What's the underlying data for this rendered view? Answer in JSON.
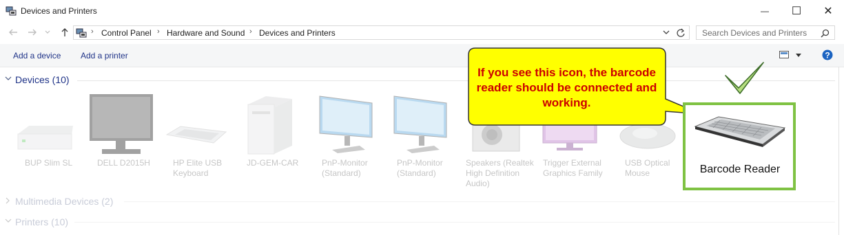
{
  "window": {
    "title": "Devices and Printers",
    "icon": "devices-and-printers-icon",
    "minimize_glyph": "—",
    "maximize_glyph": "☐",
    "close_glyph": "✕"
  },
  "address": {
    "crumbs": [
      "Control Panel",
      "Hardware and Sound",
      "Devices and Printers"
    ],
    "search_placeholder": "Search Devices and Printers"
  },
  "commands": {
    "add_device": "Add a device",
    "add_printer": "Add a printer"
  },
  "groups": {
    "devices": {
      "title": "Devices (10)"
    },
    "multimedia": {
      "title": "Multimedia Devices (2)"
    },
    "printers": {
      "title": "Printers (10)"
    }
  },
  "devices": [
    {
      "label": "BUP Slim SL",
      "icon": "external-drive-icon"
    },
    {
      "label": "DELL D2015H",
      "icon": "monitor-icon"
    },
    {
      "label": "HP Elite USB\nKeyboard",
      "icon": "keyboard-icon"
    },
    {
      "label": "JD-GEM-CAR",
      "icon": "computer-tower-icon"
    },
    {
      "label": "PnP-Monitor\n(Standard)",
      "icon": "monitor-icon"
    },
    {
      "label": "PnP-Monitor\n(Standard)",
      "icon": "monitor-icon"
    },
    {
      "label": "Speakers (Realtek\nHigh Definition\nAudio)",
      "icon": "speaker-icon"
    },
    {
      "label": "Trigger External\nGraphics Family",
      "icon": "monitor-icon"
    },
    {
      "label": "USB Optical\nMouse",
      "icon": "mouse-icon"
    }
  ],
  "callout": {
    "text": "If you see this icon, the barcode reader should be connected and working.",
    "fill": "#ffff00"
  },
  "highlight": {
    "label": "Barcode Reader",
    "border_color": "#7fc243",
    "check_color": "#7fc243"
  }
}
